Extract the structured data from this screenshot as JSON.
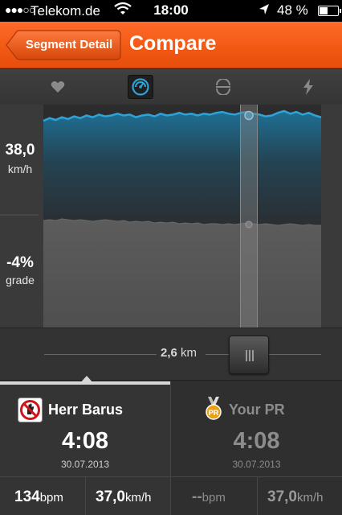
{
  "status_bar": {
    "signal": "●●●○○",
    "carrier": "Telekom.de",
    "time": "18:00",
    "battery_pct": "48 %",
    "battery_level": 0.48
  },
  "nav": {
    "back_label": "Segment Detail",
    "title": "Compare"
  },
  "tabs": [
    {
      "icon": "heart-icon",
      "active": false
    },
    {
      "icon": "speedometer-icon",
      "active": true
    },
    {
      "icon": "cadence-icon",
      "active": false
    },
    {
      "icon": "power-bolt-icon",
      "active": false
    }
  ],
  "chart": {
    "speed_value": "38,0",
    "speed_unit": "km/h",
    "grade_value": "-4%",
    "grade_unit": "grade"
  },
  "chart_data": {
    "type": "area",
    "series": [
      {
        "values": [
          37.6,
          37.9,
          37.7,
          38.0,
          37.8,
          38.1,
          37.9,
          38.2,
          38.0,
          38.3,
          38.1,
          38.2,
          38.4,
          38.2,
          38.3,
          38.0,
          38.2,
          38.3,
          38.1,
          38.4,
          38.2,
          38.3,
          38.5,
          38.3,
          38.4,
          38.2,
          38.4,
          38.3,
          38.5,
          38.6,
          38.4,
          38.3,
          38.5,
          38.6,
          38.4,
          38.3,
          38.1,
          38.2,
          38.5,
          38.7,
          38.4,
          38.6,
          38.3,
          38.5,
          38.2,
          38.0
        ]
      },
      {
        "values": [
          -3.6,
          -3.5,
          -3.6,
          -3.4,
          -3.5,
          -3.6,
          -3.5,
          -3.6,
          -3.7,
          -3.6,
          -3.5,
          -3.6,
          -3.7,
          -3.6,
          -3.8,
          -3.7,
          -3.8,
          -3.7,
          -3.9,
          -3.8,
          -3.9,
          -3.8,
          -4.0,
          -3.9,
          -4.0,
          -3.9,
          -4.1,
          -4.0,
          -4.0,
          -4.1,
          -4.0,
          -4.1,
          -4.0,
          -3.9,
          -4.0,
          -4.1,
          -4.0,
          -4.1,
          -4.2,
          -4.1,
          -4.0,
          -4.1,
          -4.2,
          -4.1,
          -4.2,
          -4.2
        ]
      }
    ],
    "scrub_index": 37
  },
  "slider": {
    "distance": "2,6",
    "unit": "km"
  },
  "compare": {
    "left": {
      "name": "Herr Barus",
      "time": "4:08",
      "date": "30.07.2013",
      "bpm_value": "134",
      "bpm_unit": "bpm",
      "speed_value": "37,0",
      "speed_unit": "km/h"
    },
    "right": {
      "name": "Your PR",
      "time": "4:08",
      "date": "30.07.2013",
      "bpm_value": "--",
      "bpm_unit": "bpm",
      "speed_value": "37,0",
      "speed_unit": "km/h"
    }
  },
  "colors": {
    "accent": "#f25a14",
    "speed_line": "#2ea3d8",
    "pr_muted": "#8c8c8c"
  }
}
